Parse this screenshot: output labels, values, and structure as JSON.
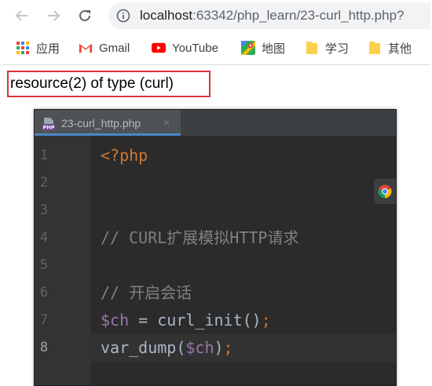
{
  "browser": {
    "back_icon": "arrow-left-icon",
    "forward_icon": "arrow-right-icon",
    "reload_icon": "reload-icon",
    "address": {
      "info_icon": "info-icon",
      "host": "localhost",
      "path": ":63342/php_learn/23-curl_http.php?"
    }
  },
  "bookmarks": [
    {
      "icon": "apps-grid-icon",
      "label": "应用"
    },
    {
      "icon": "gmail-icon",
      "label": "Gmail"
    },
    {
      "icon": "youtube-icon",
      "label": "YouTube"
    },
    {
      "icon": "maps-icon",
      "label": "地图"
    },
    {
      "icon": "folder-icon",
      "label": "学习"
    },
    {
      "icon": "folder-icon",
      "label": "其他"
    }
  ],
  "output": {
    "text": "resource(2) of type (curl)",
    "highlight_color": "#d9343c"
  },
  "ide": {
    "tab": {
      "label": "23-curl_http.php",
      "close": "×",
      "icon": "php-file-icon"
    },
    "lines": [
      {
        "num": "1",
        "tokens": [
          {
            "t": "tag",
            "v": "<?php"
          }
        ]
      },
      {
        "num": "2",
        "tokens": []
      },
      {
        "num": "3",
        "tokens": []
      },
      {
        "num": "4",
        "tokens": [
          {
            "t": "comment",
            "v": "// CURL扩展模拟HTTP请求"
          }
        ]
      },
      {
        "num": "5",
        "tokens": []
      },
      {
        "num": "6",
        "tokens": [
          {
            "t": "comment",
            "v": "// 开启会话"
          }
        ]
      },
      {
        "num": "7",
        "tokens": [
          {
            "t": "var",
            "v": "$ch"
          },
          {
            "t": "plain",
            "v": " = curl_init()"
          },
          {
            "t": "semi",
            "v": ";"
          }
        ]
      },
      {
        "num": "8",
        "current": true,
        "tokens": [
          {
            "t": "plain",
            "v": "var_dump("
          },
          {
            "t": "var",
            "v": "$ch"
          },
          {
            "t": "plain",
            "v": ")"
          },
          {
            "t": "semi",
            "v": ";"
          }
        ]
      }
    ],
    "colors": {
      "background": "#2b2b2b",
      "keyword": "#cc7832",
      "comment": "#808080",
      "variable": "#9876aa",
      "text": "#a9b7c6"
    },
    "float_icon": "chrome-icon"
  }
}
